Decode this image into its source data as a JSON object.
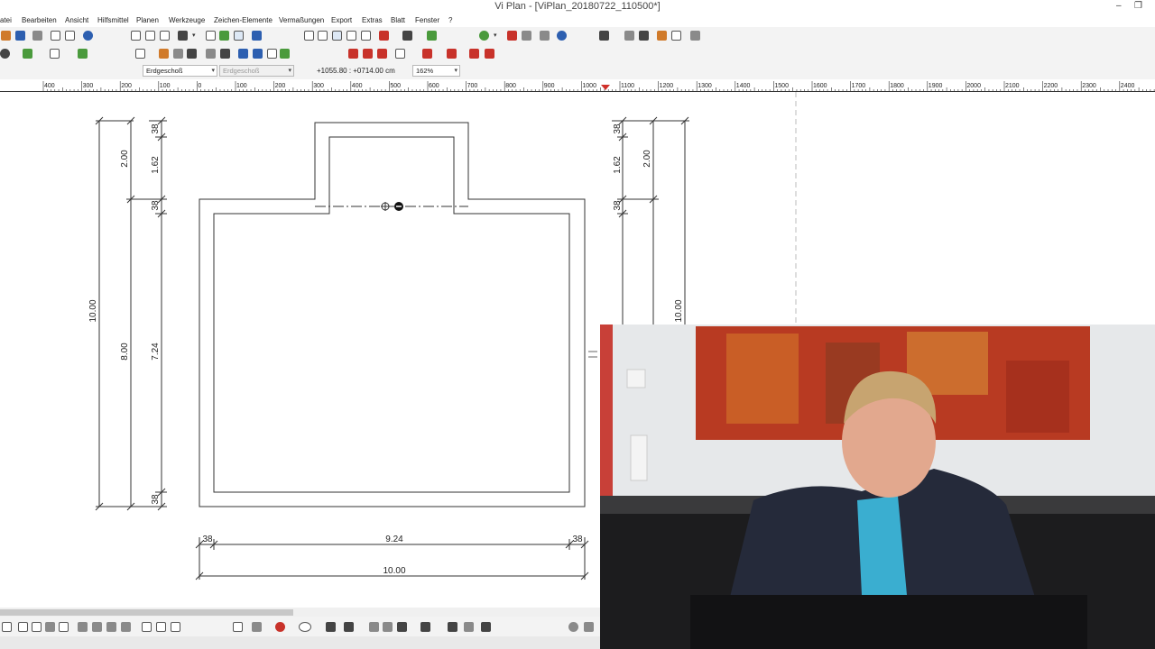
{
  "window": {
    "title": "Vi Plan - [ViPlan_20180722_110500*]",
    "controls": [
      "–",
      "❐",
      "✕"
    ]
  },
  "menu": [
    "atei",
    "Bearbeiten",
    "Ansicht",
    "Hilfsmittel",
    "Planen",
    "Werkzeuge",
    "Zeichen-Elemente",
    "Vermaßungen",
    "Export",
    "Extras",
    "Blatt",
    "Fenster",
    "?"
  ],
  "toolbar": {
    "floor_select": "Erdgeschoß",
    "floor_select_disabled": "Erdgeschoß",
    "coordinates": "+1055.80 : +0714.00 cm",
    "zoom": "162%"
  },
  "ruler": {
    "labels": [
      "400",
      "300",
      "200",
      "100",
      "0",
      "100",
      "200",
      "300",
      "400",
      "500",
      "600",
      "700",
      "800",
      "900",
      "1000",
      "1100",
      "1200",
      "1300",
      "1400",
      "1500",
      "1600",
      "1700",
      "1800",
      "1900",
      "2000",
      "2100",
      "2200",
      "2300",
      "2400"
    ]
  },
  "drawing": {
    "left_dims": {
      "total": "10.00",
      "upper": "2.00",
      "lower": "8.00",
      "inner_top": "38",
      "inner_upper": "1.62",
      "inner_mid": "38",
      "inner_lower": "7.24",
      "inner_bottom": "38"
    },
    "right_dims": {
      "top": "38",
      "upper_inner": "1.62",
      "upper": "2.00",
      "mid": "38",
      "total": "10.00"
    },
    "bottom_dims": {
      "left": "38",
      "inner": "9.24",
      "right": "38",
      "total": "10.00"
    }
  },
  "icons": [
    "open-icon",
    "save-icon",
    "print-icon",
    "copy-icon",
    "paste-icon",
    "info-icon",
    "zoom-icon",
    "pan-icon",
    "snap-icon",
    "measure-icon",
    "pdf-icon",
    "home-icon",
    "layer-icon",
    "pointer-icon",
    "text-icon",
    "circle-icon",
    "ellipse-icon",
    "line-icon"
  ]
}
